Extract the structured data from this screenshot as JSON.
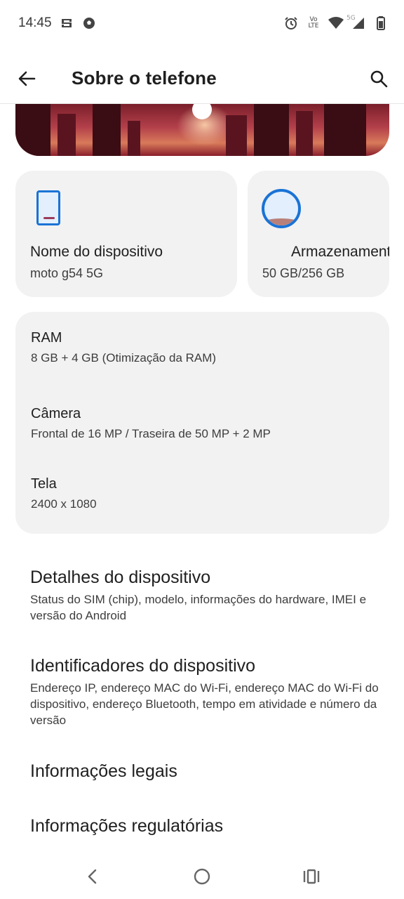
{
  "status_bar": {
    "time": "14:45",
    "left_icons": [
      "screen-cast-icon",
      "soccer-ball-icon"
    ],
    "right_icons": [
      "alarm-icon",
      "volte-icon",
      "wifi-icon",
      "signal-icon",
      "battery-icon"
    ],
    "volte_label_1": "Vo",
    "volte_label_2": "LTE",
    "network_label": "5G"
  },
  "app_bar": {
    "title": "Sobre o telefone"
  },
  "cards": {
    "device": {
      "title": "Nome do dispositivo",
      "value": "moto g54 5G"
    },
    "storage": {
      "title": "Armazenamento",
      "value": "50 GB/256 GB"
    }
  },
  "specs": {
    "ram": {
      "label": "RAM",
      "value": "8 GB + 4 GB (Otimização da RAM)"
    },
    "camera": {
      "label": "Câmera",
      "value": "Frontal de 16 MP / Traseira de 50 MP + 2 MP"
    },
    "screen": {
      "label": "Tela",
      "value": "2400 x 1080"
    }
  },
  "list": {
    "device_details": {
      "title": "Detalhes do dispositivo",
      "desc": "Status do SIM (chip), modelo, informações do hardware, IMEI e versão do Android"
    },
    "device_identifiers": {
      "title": "Identificadores do dispositivo",
      "desc": "Endereço IP, endereço MAC do Wi-Fi, endereço MAC do Wi-Fi do dispositivo, endereço Bluetooth, tempo em atividade e número da versão"
    },
    "legal": {
      "title": "Informações legais"
    },
    "regulatory": {
      "title": "Informações regulatórias"
    }
  },
  "nav": {
    "icons": [
      "back-nav-icon",
      "home-nav-icon",
      "recents-nav-icon"
    ]
  },
  "colors": {
    "accent": "#1a73d6",
    "card_bg": "#f2f2f2",
    "text_primary": "#1f1f1f",
    "text_secondary": "#3d3d3d"
  }
}
